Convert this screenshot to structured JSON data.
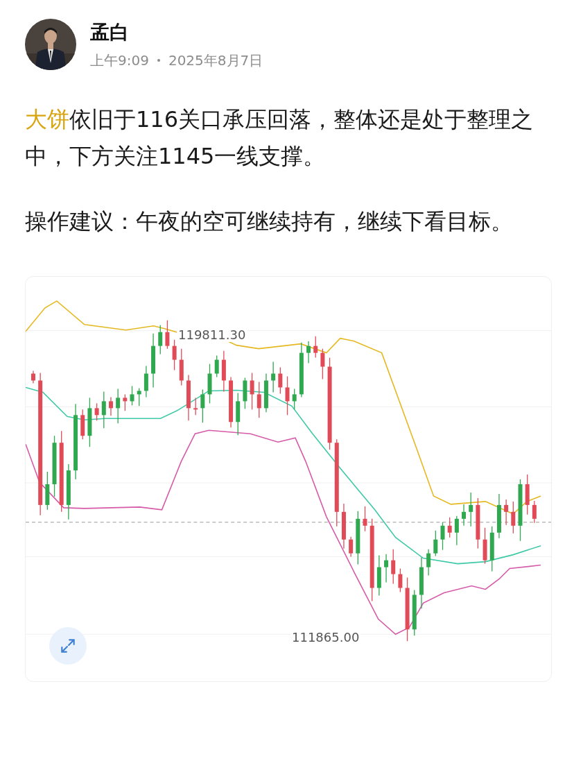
{
  "post": {
    "author": "孟白",
    "time": "上午9:09",
    "date": "2025年8月7日",
    "paragraphs": [
      {
        "highlight": "大饼",
        "text": "依旧于116关口承压回落，整体还是处于整理之中，下方关注1145一线支撑。"
      },
      {
        "text": "操作建议：午夜的空可继续持有，继续下看目标。"
      }
    ]
  },
  "chart": {
    "high_label": "119811.30",
    "low_label": "111865.00"
  }
}
